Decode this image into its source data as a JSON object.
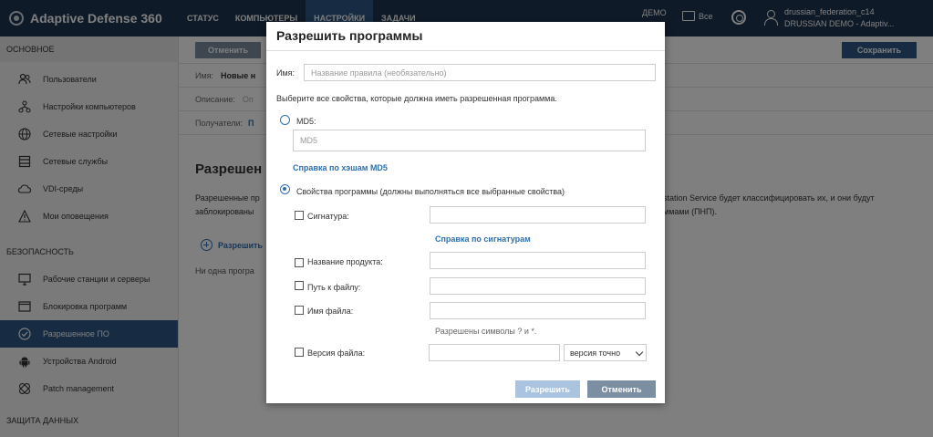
{
  "app": {
    "logo_text": "Adaptive Defense 360",
    "nav": [
      "СТАТУС",
      "КОМПЬЮТЕРЫ",
      "НАСТРОЙКИ",
      "ЗАДАЧИ"
    ],
    "demo_label": "ДЕМО",
    "filter_label": "Все",
    "user_name": "drussian_federation_c14",
    "user_org": "DRUSSIAN DEMO - Adaptiv..."
  },
  "sidebar": {
    "section_main": "ОСНОВНОЕ",
    "main_items": [
      {
        "label": "Пользователи",
        "icon": "users-icon"
      },
      {
        "label": "Настройки компьютеров",
        "icon": "network-icon"
      },
      {
        "label": "Сетевые настройки",
        "icon": "globe-icon"
      },
      {
        "label": "Сетевые службы",
        "icon": "server-icon"
      },
      {
        "label": "VDI-среды",
        "icon": "cloud-icon"
      },
      {
        "label": "Мои оповещения",
        "icon": "warning-icon"
      }
    ],
    "section_security": "БЕЗОПАСНОСТЬ",
    "security_items": [
      {
        "label": "Рабочие станции и серверы",
        "icon": "monitor-icon"
      },
      {
        "label": "Блокировка программ",
        "icon": "window-icon"
      },
      {
        "label": "Разрешенное ПО",
        "icon": "check-circle-icon",
        "active": true
      },
      {
        "label": "Устройства Android",
        "icon": "android-icon"
      },
      {
        "label": "Patch management",
        "icon": "patch-icon"
      }
    ],
    "section_data": "ЗАЩИТА ДАННЫХ"
  },
  "main": {
    "cancel_label": "Отменить",
    "save_label": "Сохранить",
    "name_label": "Имя:",
    "name_value": "Новые н",
    "desc_label": "Описание:",
    "desc_value": "Оп",
    "recipients_label": "Получатели:",
    "recipients_link": "П",
    "heading": "Разрешен",
    "desc_line1_left": "Разрешенные пр",
    "desc_line2_left": "заблокированы",
    "desc_line1_right": "station Service будет классифицировать их, и они будут",
    "desc_line2_right": "ммами (ПНП).",
    "add_link": "Разрешить",
    "no_programs": "Ни одна програ"
  },
  "modal": {
    "title": "Разрешить программы",
    "name_label": "Имя:",
    "name_placeholder": "Название правила (необязательно)",
    "instruction": "Выберите все свойства, которые должна иметь разрешенная программа.",
    "md5_label": "MD5:",
    "md5_placeholder": "MD5",
    "md5_help": "Справка по хэшам MD5",
    "props_label": "Свойства программы (должны выполняться все выбранные свойства)",
    "signature_label": "Сигнатура:",
    "signature_help": "Справка по сигнатурам",
    "product_label": "Название продукта:",
    "path_label": "Путь к файлу:",
    "filename_label": "Имя файла:",
    "filename_hint": "Разрешены символы ? и *.",
    "version_label": "Версия файла:",
    "version_match": "версия точно",
    "allow_button": "Разрешить",
    "cancel_button": "Отменить"
  }
}
